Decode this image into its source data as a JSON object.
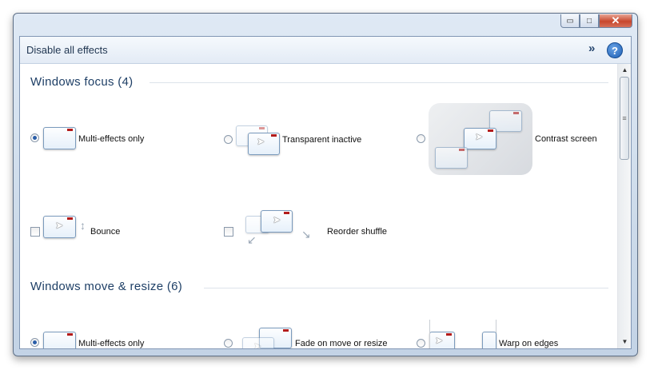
{
  "window": {
    "caption_buttons": {
      "minimize": "▭",
      "maximize": "□",
      "close": "✕"
    }
  },
  "toolbar": {
    "disable_label": "Disable all effects",
    "chevron_label": "»",
    "help_label": "?"
  },
  "sections": [
    {
      "title": "Windows focus (4)",
      "options": [
        {
          "label": "Multi-effects only",
          "control": "radio",
          "checked": true
        },
        {
          "label": "Transparent inactive",
          "control": "radio",
          "checked": false
        },
        {
          "label": "Contrast screen",
          "control": "radio",
          "checked": false
        },
        {
          "label": "Bounce",
          "control": "checkbox",
          "checked": false
        },
        {
          "label": "Reorder shuffle",
          "control": "checkbox",
          "checked": false
        }
      ]
    },
    {
      "title": "Windows move & resize (6)",
      "options": [
        {
          "label": "Multi-effects only",
          "control": "radio",
          "checked": true
        },
        {
          "label": "Fade on move or resize",
          "control": "radio",
          "checked": false
        },
        {
          "label": "Warp on edges",
          "control": "radio",
          "checked": false
        }
      ]
    }
  ],
  "scrollbar": {
    "up": "▲",
    "down": "▼",
    "grip": "≡"
  },
  "colors": {
    "accent": "#1e3f66",
    "tab_red": "#b31b1b",
    "frame": "#cddbea"
  },
  "icons": [
    "minimize-icon",
    "maximize-icon",
    "close-icon",
    "chevron-right-icon",
    "help-icon",
    "cursor-icon",
    "resize-arrow-icon"
  ]
}
